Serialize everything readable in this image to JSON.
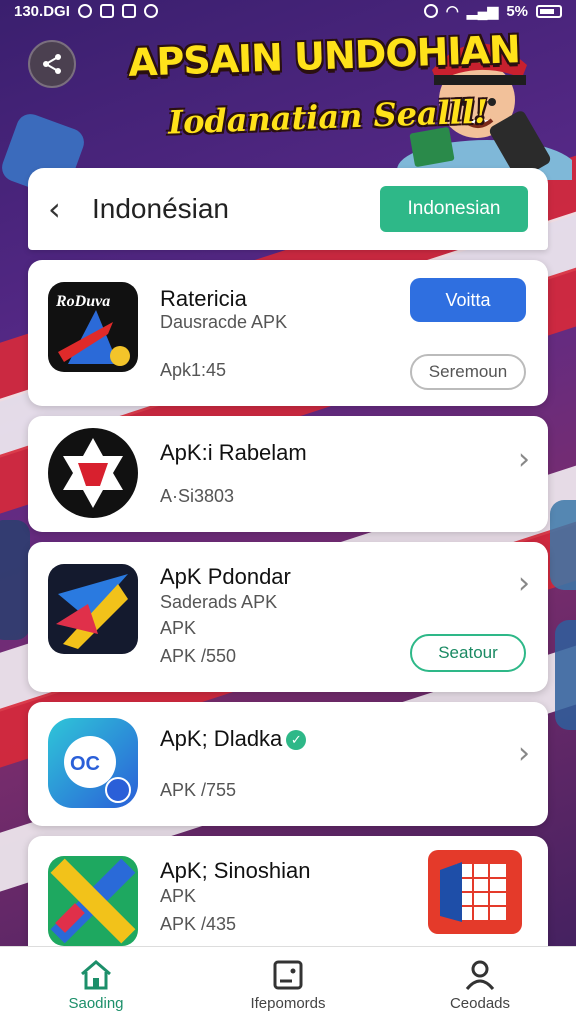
{
  "status_bar": {
    "time": "130.DGI",
    "battery": "5%"
  },
  "banner": {
    "title": "APSAIN UNDOHIAN",
    "subtitle": "Iodanatian Sealll!"
  },
  "header": {
    "title": "Indonésian",
    "button_label": "Indonesian"
  },
  "apps": [
    {
      "name": "Ratericia",
      "subtitle": "Dausracde APK",
      "meta": "Apk1:45",
      "primary_button": "Voitta",
      "secondary_button": "Seremoun",
      "icon_text": "RoDuva"
    },
    {
      "name": "ApK:i Rabelam",
      "meta": "A·Si3803"
    },
    {
      "name": "ApK Pdondar",
      "subtitle": "Saderads APK",
      "line2": "APK",
      "meta": "APK /550",
      "button": "Seatour"
    },
    {
      "name": "ApK; Dladka",
      "meta": "APK /755",
      "icon_text": "OC"
    },
    {
      "name": "ApK; Sinoshian",
      "line2": "APK",
      "meta": "APK /435"
    }
  ],
  "bottom_nav": [
    {
      "label": "Saoding",
      "icon": "home-icon",
      "active": true
    },
    {
      "label": "Ifepomords",
      "icon": "dashboard-icon",
      "active": false
    },
    {
      "label": "Ceodads",
      "icon": "profile-icon",
      "active": false
    }
  ],
  "colors": {
    "accent": "#2eb888",
    "primary_blue": "#2f6fe0",
    "banner_yellow": "#ffe21a"
  }
}
